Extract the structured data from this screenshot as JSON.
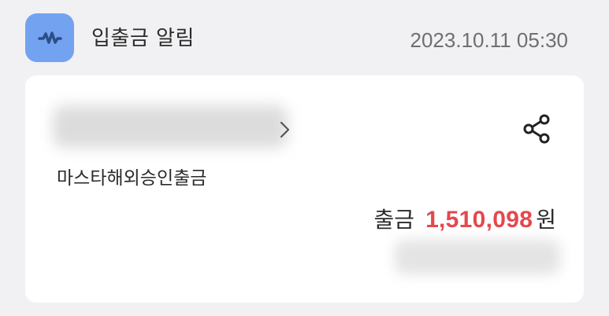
{
  "app": {
    "title": "입출금 알림",
    "icon": "wave-logo-icon",
    "icon_color": "#73a2f1"
  },
  "notification": {
    "timestamp": "2023.10.11 05:30"
  },
  "card": {
    "account_name_redacted": true,
    "transaction_type": "마스타해외승인출금",
    "amount_label": "출금",
    "amount_value": "1,510,098",
    "amount_unit": "원",
    "amount_color": "#e5484d",
    "balance_redacted": true
  }
}
